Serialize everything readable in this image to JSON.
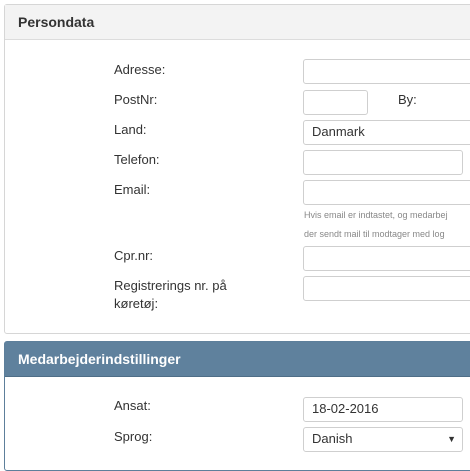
{
  "persondata": {
    "title": "Persondata",
    "address_label": "Adresse:",
    "postnr_label": "PostNr:",
    "by_label": "By:",
    "land_label": "Land:",
    "land_value": "Danmark",
    "phone_label": "Telefon:",
    "email_label": "Email:",
    "email_hint_line1": "Hvis email er indtastet, og medarbej",
    "email_hint_line2": "der sendt mail til modtager med log",
    "cpr_label": "Cpr.nr:",
    "reg_label_line1": "Registrerings nr. på",
    "reg_label_line2": "køretøj:"
  },
  "settings": {
    "title": "Medarbejderindstillinger",
    "hired_label": "Ansat:",
    "hired_value": "18-02-2016",
    "language_label": "Sprog:",
    "language_value": "Danish"
  }
}
